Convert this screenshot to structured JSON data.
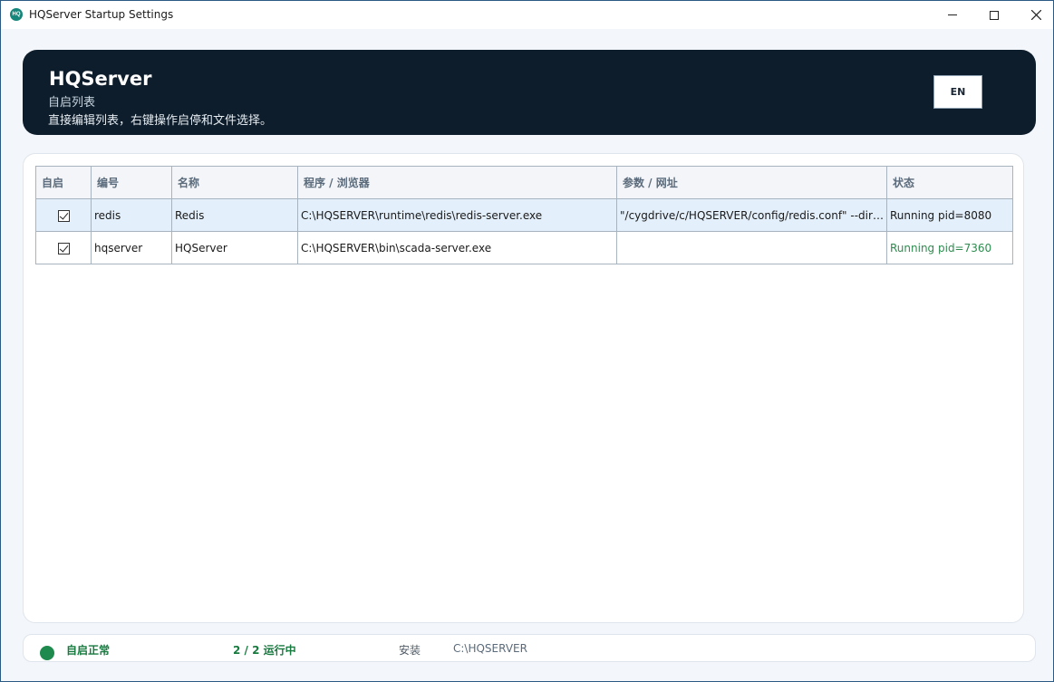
{
  "window": {
    "title": "HQServer Startup Settings",
    "icon": "hq-app-icon"
  },
  "banner": {
    "title": "HQServer",
    "subtitle": "自启列表",
    "description": "直接编辑列表，右键操作启停和文件选择。",
    "lang_button": "EN"
  },
  "table": {
    "headers": [
      "自启",
      "编号",
      "名称",
      "程序 / 浏览器",
      "参数 / 网址",
      "状态"
    ],
    "rows": [
      {
        "autostart": true,
        "id": "redis",
        "name": "Redis",
        "program": "C:\\HQSERVER\\runtime\\redis\\redis-server.exe",
        "args": "\"/cygdrive/c/HQSERVER/config/redis.conf\" --dir \"/cygdrive/c/HQSERVER/data/redis\"",
        "status": "Running pid=8080",
        "selected": true
      },
      {
        "autostart": true,
        "id": "hqserver",
        "name": "HQServer",
        "program": "C:\\HQSERVER\\bin\\scada-server.exe",
        "args": "",
        "status": "Running pid=7360",
        "selected": false
      }
    ]
  },
  "footer": {
    "state": "自启正常",
    "count": "2 / 2 运行中",
    "install_label": "安装",
    "install_path": "C:\\HQSERVER",
    "status_color": "#1e8a4e"
  },
  "colors": {
    "banner_bg": "#0e1d2b",
    "status_running": "#2e8b4f",
    "selected_row": "#e3effb"
  }
}
